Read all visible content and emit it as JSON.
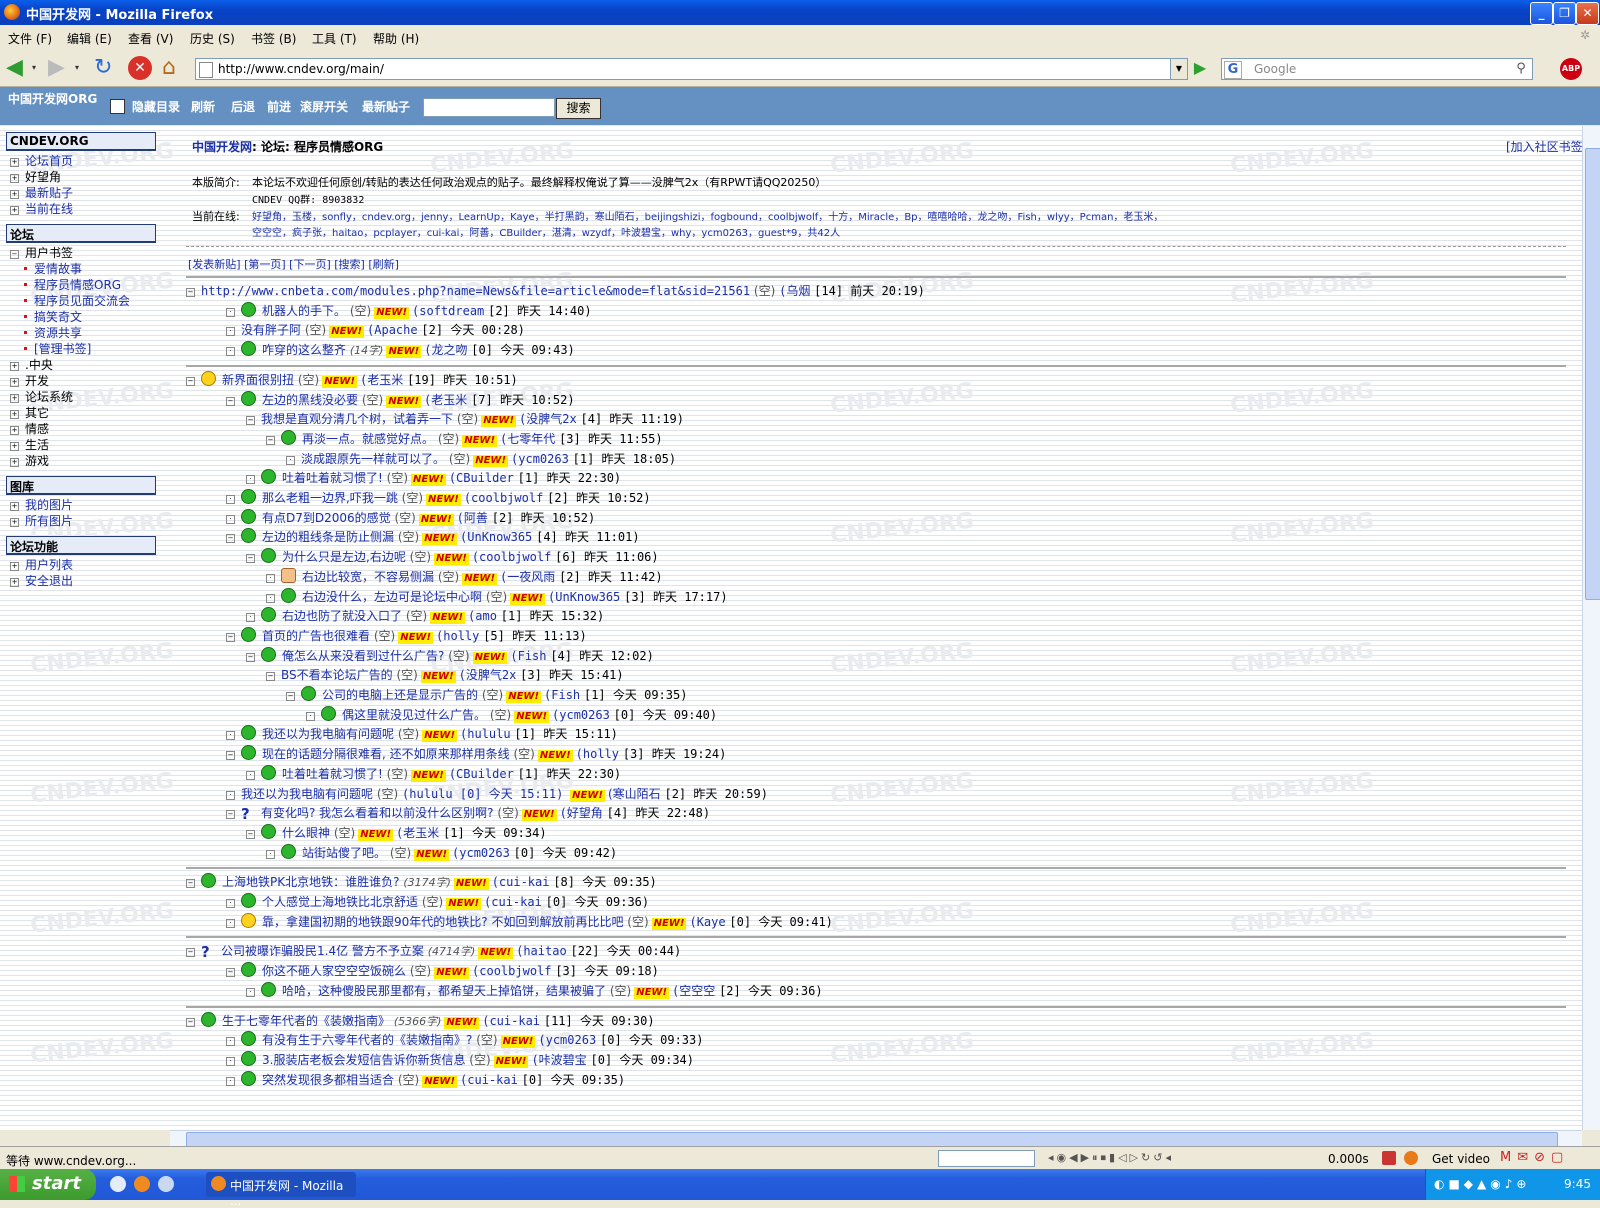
{
  "window": {
    "title": "中国开发网 - Mozilla Firefox"
  },
  "menu": [
    "文件 (F)",
    "编辑 (E)",
    "查看 (V)",
    "历史 (S)",
    "书签 (B)",
    "工具 (T)",
    "帮助 (H)"
  ],
  "nav": {
    "url": "http://www.cndev.org/main/",
    "search_placeholder": "Google",
    "abp": "ABP"
  },
  "site": {
    "logo": "中国开发网ORG",
    "links": [
      "隐藏目录",
      "刷新",
      "后退",
      "前进",
      "滚屏开关",
      "最新贴子"
    ],
    "search_button": "搜索"
  },
  "sidebar": {
    "sec1": "CNDEV.ORG",
    "sec1_items": [
      "论坛首页",
      "好望角",
      "最新贴子",
      "当前在线"
    ],
    "sec2": "论坛",
    "bookmark": "用户书签",
    "bookmark_items": [
      "爱情故事",
      "程序员情感ORG",
      "程序员见面交流会",
      "搞笑奇文",
      "资源共享",
      "[管理书签]"
    ],
    "forum_items": [
      ".中央",
      "开发",
      "论坛系统",
      "其它",
      "情感",
      "生活",
      "游戏"
    ],
    "sec3": "图库",
    "gallery_items": [
      "我的图片",
      "所有图片"
    ],
    "sec4": "论坛功能",
    "func_items": [
      "用户列表",
      "安全退出"
    ]
  },
  "forum": {
    "crumb_site": "中国开发网",
    "crumb_rest": ": 论坛: 程序员情感ORG",
    "join": "[加入社区书签]",
    "intro_label": "本版简介:",
    "intro": "本论坛不欢迎任何原创/转贴的表达任何政治观点的贴子。最终解释权俺说了算——没脾气2x（有RPWT请QQ20250）",
    "qq": "CNDEV QQ群: 8903832",
    "online_label": "当前在线:",
    "online1": "好望角，玉楼，sonfly，cndev.org，jenny，LearnUp，Kaye，半打黑韵，寒山陌石，beijingshizi，fogbound，coolbjwolf，十方，Miracle，Bp，嘻嘻哈哈，龙之吻，Fish，wlyy，Pcman，老玉米，",
    "online2": "空空空，疯子张，haitao，pcplayer，cui-kai，阿善，CBuilder，湛清，wzydf，咔波碧宝，why，ycm0263，guest*9，共42人",
    "actions": "[发表新贴] [第一页] [下一页] [搜索] [刷新]"
  },
  "threads": [
    {
      "lvl": 0,
      "face": "none",
      "t": "http://www.cnbeta.com/modules.php?name=News&file=article&mode=flat&sid=21561",
      "s": "(空)",
      "n": false,
      "a": "(乌烟",
      "m": "[14] 前天 20:19)"
    },
    {
      "lvl": 1,
      "face": "g",
      "t": "机器人的手下。",
      "s": "(空)",
      "n": true,
      "a": "(softdream",
      "m": "[2] 昨天 14:40)"
    },
    {
      "lvl": 1,
      "face": "none",
      "t": "没有胖子阿",
      "s": "(空)",
      "n": true,
      "a": "(Apache",
      "m": "[2] 今天 00:28)"
    },
    {
      "lvl": 1,
      "face": "g",
      "t": "咋穿的这么整齐",
      "s": "(14字)",
      "n": true,
      "a": "(龙之吻",
      "m": "[0] 今天 09:43)"
    },
    {
      "sep": true
    },
    {
      "lvl": 0,
      "face": "y",
      "t": "新界面很别扭",
      "s": "(空)",
      "n": true,
      "a": "(老玉米",
      "m": "[19] 昨天 10:51)"
    },
    {
      "lvl": 1,
      "face": "g",
      "t": "左边的黑线没必要",
      "s": "(空)",
      "n": true,
      "a": "(老玉米",
      "m": "[7] 昨天 10:52)"
    },
    {
      "lvl": 2,
      "face": "none",
      "t": "我想是直观分清几个树，试着弄一下",
      "s": "(空)",
      "n": true,
      "a": "(没脾气2x",
      "m": "[4] 昨天 11:19)"
    },
    {
      "lvl": 3,
      "face": "g",
      "t": "再淡一点。就感觉好点。",
      "s": "(空)",
      "n": true,
      "a": "(七零年代",
      "m": "[3] 昨天 11:55)"
    },
    {
      "lvl": 4,
      "face": "none",
      "t": "淡成跟原先一样就可以了。",
      "s": "(空)",
      "n": true,
      "a": "(ycm0263",
      "m": "[1] 昨天 18:05)"
    },
    {
      "lvl": 2,
      "face": "g",
      "t": "吐着吐着就习惯了!",
      "s": "(空)",
      "n": true,
      "a": "(CBuilder",
      "m": "[1] 昨天 22:30)"
    },
    {
      "lvl": 1,
      "face": "g",
      "t": "那么老粗一边界,吓我一跳",
      "s": "(空)",
      "n": true,
      "a": "(coolbjwolf",
      "m": "[2] 昨天 10:52)"
    },
    {
      "lvl": 1,
      "face": "g",
      "t": "有点D7到D2006的感觉",
      "s": "(空)",
      "n": true,
      "a": "(阿善",
      "m": "[2] 昨天 10:52)"
    },
    {
      "lvl": 1,
      "face": "g",
      "t": "左边的粗线条是防止侧漏",
      "s": "(空)",
      "n": true,
      "a": "(UnKnow365",
      "m": "[4] 昨天 11:01)"
    },
    {
      "lvl": 2,
      "face": "g",
      "t": "为什么只是左边,右边呢",
      "s": "(空)",
      "n": true,
      "a": "(coolbjwolf",
      "m": "[6] 昨天 11:06)"
    },
    {
      "lvl": 3,
      "face": "h",
      "t": "右边比较宽，不容易侧漏",
      "s": "(空)",
      "n": true,
      "a": "(一夜风雨",
      "m": "[2] 昨天 11:42)"
    },
    {
      "lvl": 3,
      "face": "g",
      "t": "右边没什么，左边可是论坛中心啊",
      "s": "(空)",
      "n": true,
      "a": "(UnKnow365",
      "m": "[3] 昨天 17:17)"
    },
    {
      "lvl": 2,
      "face": "g",
      "t": "右边也防了就没入口了",
      "s": "(空)",
      "n": true,
      "a": "(amo",
      "m": "[1] 昨天 15:32)"
    },
    {
      "lvl": 1,
      "face": "g",
      "t": "首页的广告也很难看",
      "s": "(空)",
      "n": true,
      "a": "(holly",
      "m": "[5] 昨天 11:13)"
    },
    {
      "lvl": 2,
      "face": "g",
      "t": "俺怎么从来没看到过什么广告?",
      "s": "(空)",
      "n": true,
      "a": "(Fish",
      "m": "[4] 昨天 12:02)"
    },
    {
      "lvl": 3,
      "face": "none",
      "t": "BS不看本论坛广告的",
      "s": "(空)",
      "n": true,
      "a": "(没脾气2x",
      "m": "[3] 昨天 15:41)"
    },
    {
      "lvl": 4,
      "face": "g",
      "t": "公司的电脑上还是显示广告的",
      "s": "(空)",
      "n": true,
      "a": "(Fish",
      "m": "[1] 今天 09:35)"
    },
    {
      "lvl": 5,
      "face": "g",
      "t": "偶这里就没见过什么广告。",
      "s": "(空)",
      "n": true,
      "a": "(ycm0263",
      "m": "[0] 今天 09:40)"
    },
    {
      "lvl": 1,
      "face": "g",
      "t": "我还以为我电脑有问题呢",
      "s": "(空)",
      "n": true,
      "a": "(hululu",
      "m": "[1] 昨天 15:11)"
    },
    {
      "lvl": 1,
      "face": "g",
      "t": "现在的话题分隔很难看, 还不如原来那样用条线",
      "s": "(空)",
      "n": true,
      "a": "(holly",
      "m": "[3] 昨天 19:24)"
    },
    {
      "lvl": 2,
      "face": "g",
      "t": "吐着吐着就习惯了!",
      "s": "(空)",
      "n": true,
      "a": "(CBuilder",
      "m": "[1] 昨天 22:30)"
    },
    {
      "lvl": 1,
      "face": "none",
      "t": "我还以为我电脑有问题呢",
      "s": "(空)",
      "n": false,
      "a": "(hululu [0] 今天 15:11)",
      "m": "",
      "n2": true,
      "a2": "(寒山陌石",
      "m2": "[2] 昨天 20:59)"
    },
    {
      "lvl": 1,
      "face": "q",
      "t": "有变化吗? 我怎么看着和以前没什么区别啊?",
      "s": "(空)",
      "n": true,
      "a": "(好望角",
      "m": "[4] 昨天 22:48)"
    },
    {
      "lvl": 2,
      "face": "g",
      "t": "什么眼神",
      "s": "(空)",
      "n": true,
      "a": "(老玉米",
      "m": "[1] 今天 09:34)"
    },
    {
      "lvl": 3,
      "face": "g",
      "t": "站街站傻了吧。",
      "s": "(空)",
      "n": true,
      "a": "(ycm0263",
      "m": "[0] 今天 09:42)"
    },
    {
      "sep": true
    },
    {
      "lvl": 0,
      "face": "g",
      "t": "上海地铁PK北京地铁：谁胜谁负?",
      "s": "(3174字)",
      "n": true,
      "a": "(cui-kai",
      "m": "[8] 今天 09:35)"
    },
    {
      "lvl": 1,
      "face": "g",
      "t": "个人感觉上海地铁比北京舒适",
      "s": "(空)",
      "n": true,
      "a": "(cui-kai",
      "m": "[0] 今天 09:36)"
    },
    {
      "lvl": 1,
      "face": "y",
      "t": "靠，拿建国初期的地铁跟90年代的地铁比? 不如回到解放前再比比吧",
      "s": "(空)",
      "n": true,
      "a": "(Kaye",
      "m": "[0] 今天 09:41)"
    },
    {
      "sep": true
    },
    {
      "lvl": 0,
      "face": "q",
      "t": "公司被曝诈骗股民1.4亿 警方不予立案",
      "s": "(4714字)",
      "n": true,
      "a": "(haitao",
      "m": "[22] 今天 00:44)"
    },
    {
      "lvl": 1,
      "face": "g",
      "t": "你这不砸人家空空空饭碗么",
      "s": "(空)",
      "n": true,
      "a": "(coolbjwolf",
      "m": "[3] 今天 09:18)"
    },
    {
      "lvl": 2,
      "face": "g",
      "t": "哈哈，这种傻股民那里都有，都希望天上掉馅饼，结果被骗了",
      "s": "(空)",
      "n": true,
      "a": "(空空空",
      "m": "[2] 今天 09:36)"
    },
    {
      "sep": true
    },
    {
      "lvl": 0,
      "face": "g",
      "t": "生于七零年代者的《装嫩指南》",
      "s": "(5366字)",
      "n": true,
      "a": "(cui-kai",
      "m": "[11] 今天 09:30)"
    },
    {
      "lvl": 1,
      "face": "g",
      "t": "有没有生于六零年代者的《装嫩指南》?",
      "s": "(空)",
      "n": true,
      "a": "(ycm0263",
      "m": "[0] 今天 09:33)"
    },
    {
      "lvl": 1,
      "face": "g",
      "t": "3.服装店老板会发短信告诉你新货信息",
      "s": "(空)",
      "n": true,
      "a": "(咔波碧宝",
      "m": "[0] 今天 09:34)"
    },
    {
      "lvl": 1,
      "face": "g",
      "t": "突然发现很多都相当适合",
      "s": "(空)",
      "n": true,
      "a": "(cui-kai",
      "m": "[0] 今天 09:35)"
    }
  ],
  "new_label": "NEW!",
  "status": {
    "text": "等待 www.cndev.org...",
    "timer": "0.000s",
    "getvideo": "Get video"
  },
  "taskbar": {
    "start": "start",
    "item": "中国开发网 - Mozilla ...",
    "clock": "9:45"
  },
  "watermark": "CNDEV.ORG"
}
